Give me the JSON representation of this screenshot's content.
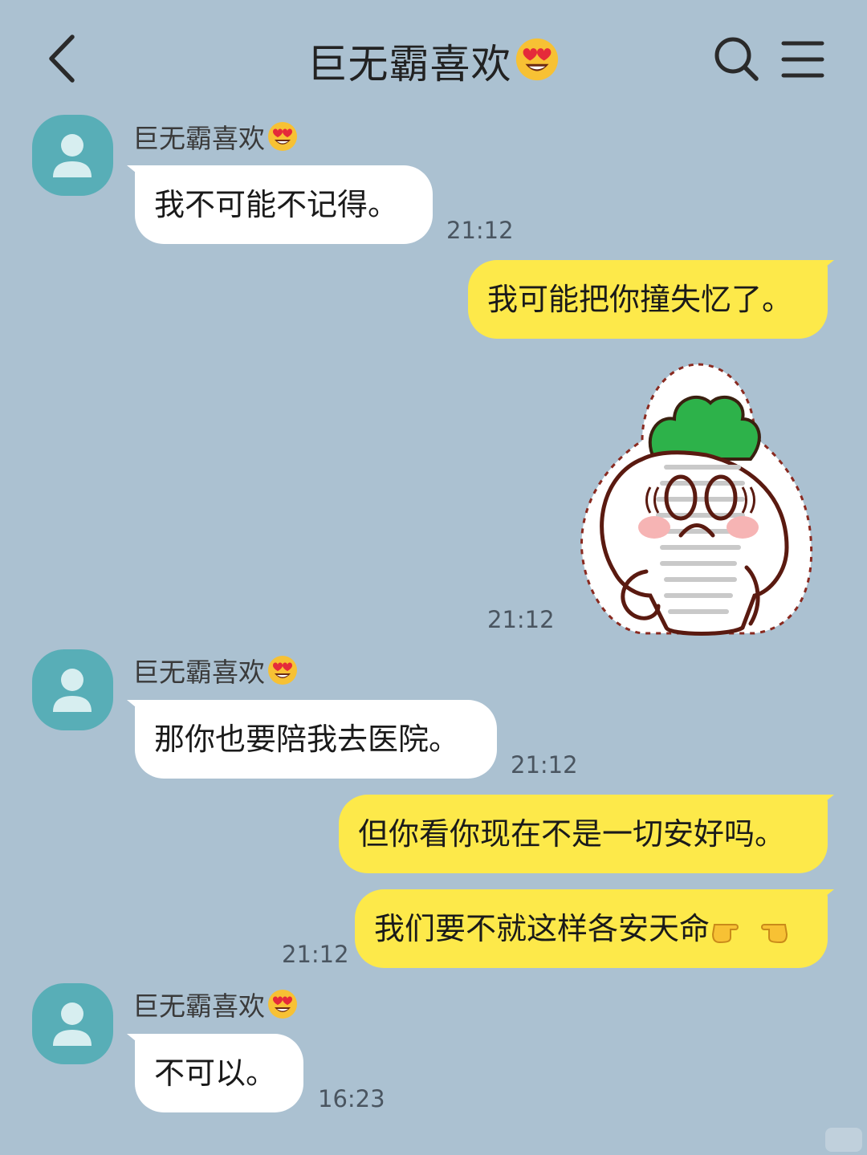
{
  "header": {
    "title": "巨无霸喜欢",
    "title_emoji": "heart-eyes-emoji"
  },
  "messages": [
    {
      "side": "in",
      "sender": "巨无霸喜欢",
      "text": "我不可能不记得。",
      "time": "21:12"
    },
    {
      "side": "out",
      "text": "我可能把你撞失忆了。"
    },
    {
      "side": "out",
      "sticker": "radish-character-sticker",
      "time": "21:12"
    },
    {
      "side": "in",
      "sender": "巨无霸喜欢",
      "text": "那你也要陪我去医院。",
      "time": "21:12"
    },
    {
      "side": "out",
      "text": "但你看你现在不是一切安好吗。"
    },
    {
      "side": "out",
      "text": "我们要不就这样各安天命",
      "emoji": "pointing-hands-emoji",
      "time": "21:12"
    },
    {
      "side": "in",
      "sender": "巨无霸喜欢",
      "text": "不可以。",
      "time": "16:23"
    }
  ],
  "icons": {
    "back": "back-chevron-icon",
    "search": "search-icon",
    "menu": "menu-icon",
    "avatar": "default-user-avatar-icon"
  },
  "colors": {
    "background": "#abc1d1",
    "incoming_bubble": "#ffffff",
    "outgoing_bubble": "#fde94a",
    "avatar": "#58aeb7"
  }
}
